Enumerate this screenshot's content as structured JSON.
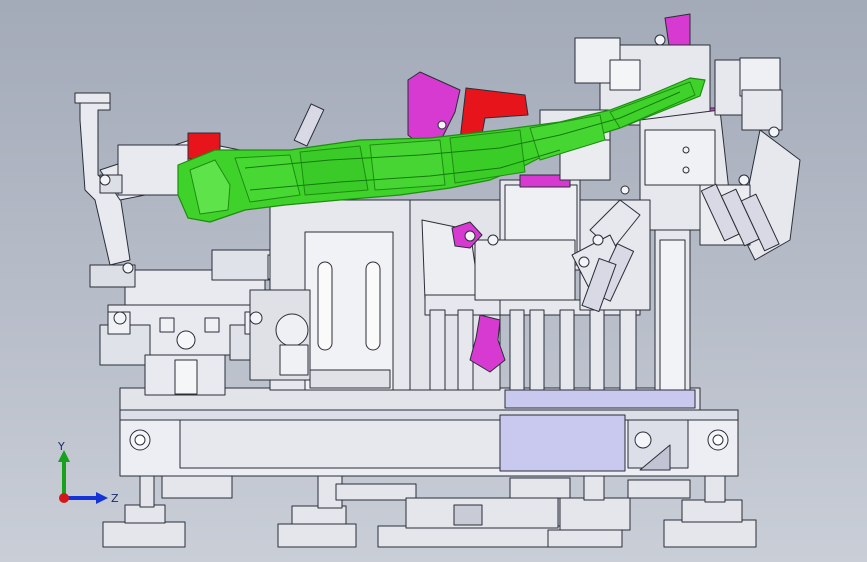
{
  "viewport": {
    "background_top": "#a3aab8",
    "background_bottom": "#c9ced7"
  },
  "colors": {
    "part_green": "#3fd22a",
    "part_green_dark": "#1f8c12",
    "part_magenta": "#d63ad0",
    "part_red": "#e8141b",
    "part_lavender": "#c9c8ee",
    "part_steel": "#e6e8ee",
    "edge": "#2a2e38"
  },
  "triad": {
    "y_label": "Y",
    "z_label": "Z",
    "y_color": "#17a11c",
    "z_color": "#1533d6",
    "x_color": "#d4161a"
  }
}
